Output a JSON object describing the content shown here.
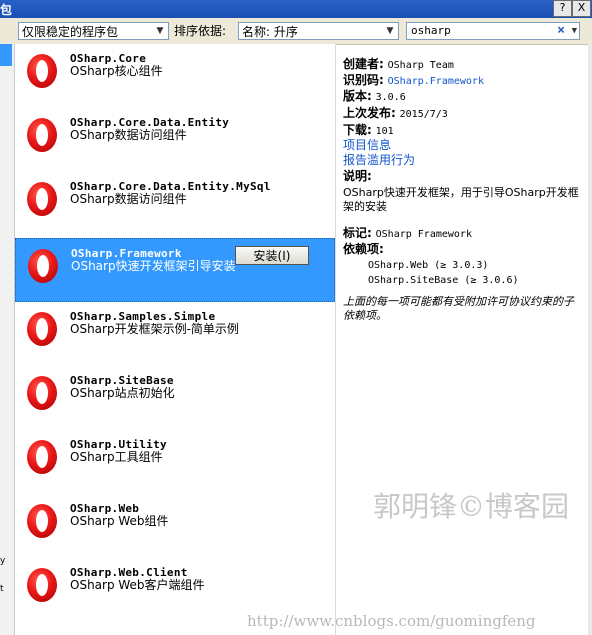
{
  "window": {
    "title_fragment": "包",
    "help_label": "?",
    "close_label": "X"
  },
  "toolbar": {
    "filter_value": "仅限稳定的程序包",
    "sort_label": "排序依据:",
    "sort_value": "名称: 升序",
    "search_value": "osharp",
    "clear_icon": "×"
  },
  "left_edge": {
    "fragment1": "y",
    "fragment2": "t"
  },
  "packages": [
    {
      "name": "OSharp.Core",
      "desc": "OSharp核心组件"
    },
    {
      "name": "OSharp.Core.Data.Entity",
      "desc": "OSharp数据访问组件"
    },
    {
      "name": "OSharp.Core.Data.Entity.MySql",
      "desc": "OSharp数据访问组件"
    },
    {
      "name": "OSharp.Framework",
      "desc": "OSharp快速开发框架引导安装",
      "selected": true,
      "install_label": "安装(I)"
    },
    {
      "name": "OSharp.Samples.Simple",
      "desc": "OSharp开发框架示例-简单示例"
    },
    {
      "name": "OSharp.SiteBase",
      "desc": "OSharp站点初始化"
    },
    {
      "name": "OSharp.Utility",
      "desc": "OSharp工具组件"
    },
    {
      "name": "OSharp.Web",
      "desc": "OSharp Web组件"
    },
    {
      "name": "OSharp.Web.Client",
      "desc": "OSharp Web客户端组件"
    }
  ],
  "details": {
    "creator_label": "创建者:",
    "creator_value": "OSharp Team",
    "id_label": "识别码:",
    "id_value": "OSharp.Framework",
    "version_label": "版本:",
    "version_value": "3.0.6",
    "published_label": "上次发布:",
    "published_value": "2015/7/3",
    "downloads_label": "下载:",
    "downloads_value": "101",
    "project_link": "项目信息",
    "report_link": "报告滥用行为",
    "description_label": "说明:",
    "description_value": "OSharp快速开发框架，用于引导OSharp开发框架的安装",
    "tags_label": "标记:",
    "tags_value": "OSharp Framework",
    "deps_label": "依赖项:",
    "dependencies": [
      "OSharp.Web (≥ 3.0.3)",
      "OSharp.SiteBase (≥ 3.0.6)"
    ],
    "note": "上面的每一项可能都有受附加许可协议约束的子依赖项。"
  },
  "watermark": {
    "text1": "郭明锋©博客园",
    "text2": "http://www.cnblogs.com/guomingfeng"
  },
  "colors": {
    "selection": "#3399ff",
    "link": "#1155cc",
    "logo_red": "#e8181a"
  }
}
